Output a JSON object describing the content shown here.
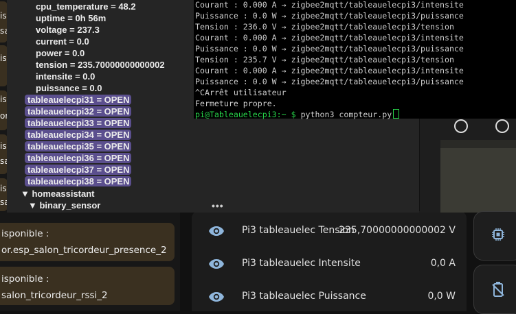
{
  "tree": {
    "attributes": [
      {
        "key": "cpu_temperature",
        "value": "48.2"
      },
      {
        "key": "uptime",
        "value": "0h 56m"
      },
      {
        "key": "voltage",
        "value": "237.3"
      },
      {
        "key": "current",
        "value": "0.0"
      },
      {
        "key": "power",
        "value": "0.0"
      },
      {
        "key": "tension",
        "value": "235.70000000000002"
      },
      {
        "key": "intensite",
        "value": "0.0"
      },
      {
        "key": "puissance",
        "value": "0.0"
      }
    ],
    "topics": [
      "tableauelecpi31 = OPEN",
      "tableauelecpi32 = OPEN",
      "tableauelecpi33 = OPEN",
      "tableauelecpi34 = OPEN",
      "tableauelecpi35 = OPEN",
      "tableauelecpi36 = OPEN",
      "tableauelecpi37 = OPEN",
      "tableauelecpi38 = OPEN"
    ],
    "nodes": [
      "▼ homeassistant",
      "▼ binary_sensor"
    ],
    "more": "•••"
  },
  "terminal": {
    "lines": [
      "Courant : 0.000 A → zigbee2mqtt/tableauelecpi3/intensite",
      "Puissance : 0.0 W → zigbee2mqtt/tableauelecpi3/puissance",
      "Tension : 236.0 V → zigbee2mqtt/tableauelecpi3/tension",
      "Courant : 0.000 A → zigbee2mqtt/tableauelecpi3/intensite",
      "Puissance : 0.0 W → zigbee2mqtt/tableauelecpi3/puissance",
      "Tension : 235.7 V → zigbee2mqtt/tableauelecpi3/tension",
      "Courant : 0.000 A → zigbee2mqtt/tableauelecpi3/intensite",
      "Puissance : 0.0 W → zigbee2mqtt/tableauelecpi3/puissance",
      "^CArrêt utilisateur",
      "Fermeture propre."
    ],
    "prompt": "pi@Tableauelecpi3:~ $",
    "command": " python3 compteur.py"
  },
  "left_edge": [
    "is",
    "sa",
    "is",
    "is",
    "or",
    "is",
    "sa",
    "is",
    "sa",
    "is",
    "sa"
  ],
  "warnings": [
    {
      "line1": "isponible :",
      "line2": "or.esp_salon_tricordeur_presence_2"
    },
    {
      "line1": "isponible :",
      "line2": "salon_tricordeur_rssi_2"
    }
  ],
  "entities": [
    {
      "name": "Pi3 tableauelec Tension",
      "value": "235,70000000000002 V"
    },
    {
      "name": "Pi3 tableauelec Intensite",
      "value": "0,0 A"
    },
    {
      "name": "Pi3 tableauelec Puissance",
      "value": "0,0 W"
    }
  ],
  "icons": {
    "entity": "eye-icon",
    "side_top": "chip-icon",
    "side_bottom": "battery-off-icon"
  },
  "colors": {
    "pill": "#5b4f8e",
    "prompt": "#27d44a",
    "warning_card": "#3a3020"
  }
}
